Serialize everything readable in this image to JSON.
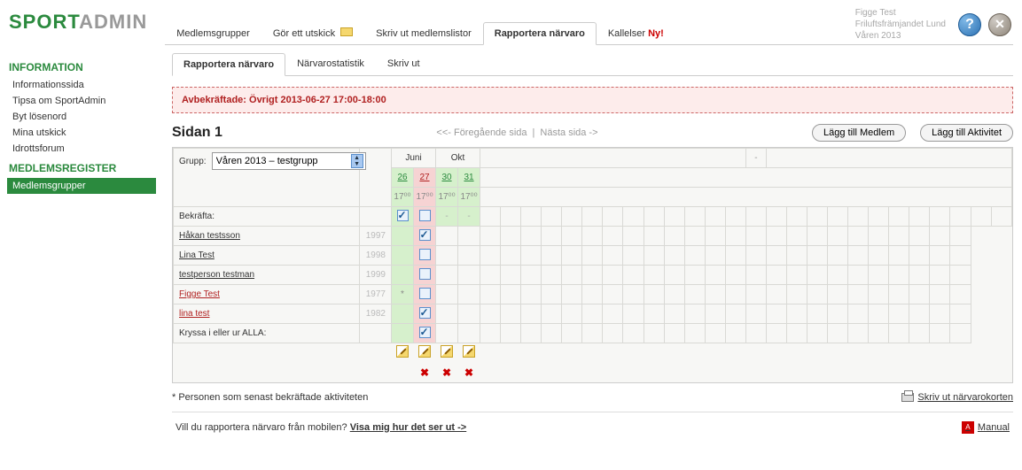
{
  "logo": {
    "part1": "SPORT",
    "part2": "ADMIN"
  },
  "user": {
    "name": "Figge Test",
    "org": "Friluftsfrämjandet Lund",
    "term": "Våren 2013"
  },
  "topnav": {
    "items": [
      {
        "label": "Medlemsgrupper"
      },
      {
        "label": "Gör ett utskick",
        "icon": "envelope"
      },
      {
        "label": "Skriv ut medlemslistor"
      },
      {
        "label": "Rapportera närvaro",
        "active": true
      },
      {
        "label": "Kallelser",
        "badge": "Ny!"
      }
    ]
  },
  "sidebar": {
    "sections": [
      {
        "title": "INFORMATION",
        "items": [
          "Informationssida",
          "Tipsa om SportAdmin",
          "Byt lösenord",
          "Mina utskick",
          "Idrottsforum"
        ]
      },
      {
        "title": "MEDLEMSREGISTER",
        "items": [
          "Medlemsgrupper"
        ],
        "activeIndex": 0
      }
    ]
  },
  "subtabs": [
    "Rapportera närvaro",
    "Närvarostatistik",
    "Skriv ut"
  ],
  "subtabActive": 0,
  "alert": "Avbekräftade: Övrigt 2013-06-27 17:00-18:00",
  "pageTitle": "Sidan 1",
  "pager": {
    "prev": "<<- Föregående sida",
    "next": "Nästa sida ->"
  },
  "buttons": {
    "addMember": "Lägg till Medlem",
    "addActivity": "Lägg till Aktivitet"
  },
  "group": {
    "label": "Grupp:",
    "value": "Våren 2013 – testgrupp"
  },
  "months": [
    "Juni",
    "Okt"
  ],
  "dates": [
    {
      "d": "26",
      "t": "17⁰⁰",
      "cls": "g"
    },
    {
      "d": "27",
      "t": "17⁰⁰",
      "cls": "r"
    },
    {
      "d": "30",
      "t": "17⁰⁰",
      "cls": "g"
    },
    {
      "d": "31",
      "t": "17⁰⁰",
      "cls": "g"
    }
  ],
  "confirmLabel": "Bekräfta:",
  "confirmRow": [
    "checked",
    "unchecked",
    "dash",
    "dash"
  ],
  "people": [
    {
      "name": "Håkan testsson",
      "year": "1997",
      "col0": "",
      "col1": "checked"
    },
    {
      "name": "Lina Test",
      "year": "1998",
      "col0": "",
      "col1": "unchecked"
    },
    {
      "name": "testperson testman",
      "year": "1999",
      "col0": "",
      "col1": "unchecked"
    },
    {
      "name": "Figge Test",
      "year": "1977",
      "col0": "*",
      "col1": "unchecked",
      "red": true
    },
    {
      "name": "lina test",
      "year": "1982",
      "col0": "",
      "col1": "checked",
      "red": true
    }
  ],
  "allLabel": "Kryssa i eller ur ALLA:",
  "allRow": "checked",
  "footnote": "* Personen som senast bekräftade aktiviteten",
  "printLink": "Skriv ut närvarokorten",
  "mobile": {
    "q": "Vill du rapportera närvaro från mobilen?",
    "link": "Visa mig hur det ser ut ->"
  },
  "manual": "Manual",
  "placeholderDash": "-"
}
